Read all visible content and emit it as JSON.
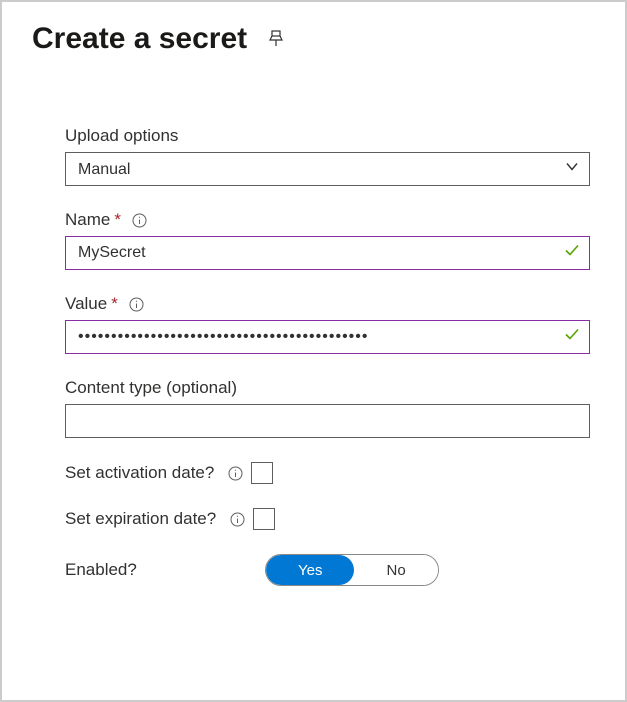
{
  "header": {
    "title": "Create a secret"
  },
  "form": {
    "upload_options": {
      "label": "Upload options",
      "value": "Manual"
    },
    "name": {
      "label": "Name",
      "value": "MySecret"
    },
    "value": {
      "label": "Value",
      "masked": "••••••••••••••••••••••••••••••••••••••••••••"
    },
    "content_type": {
      "label": "Content type (optional)",
      "value": ""
    },
    "activation_date": {
      "label": "Set activation date?"
    },
    "expiration_date": {
      "label": "Set expiration date?"
    },
    "enabled": {
      "label": "Enabled?",
      "yes": "Yes",
      "no": "No",
      "value": "yes"
    }
  }
}
